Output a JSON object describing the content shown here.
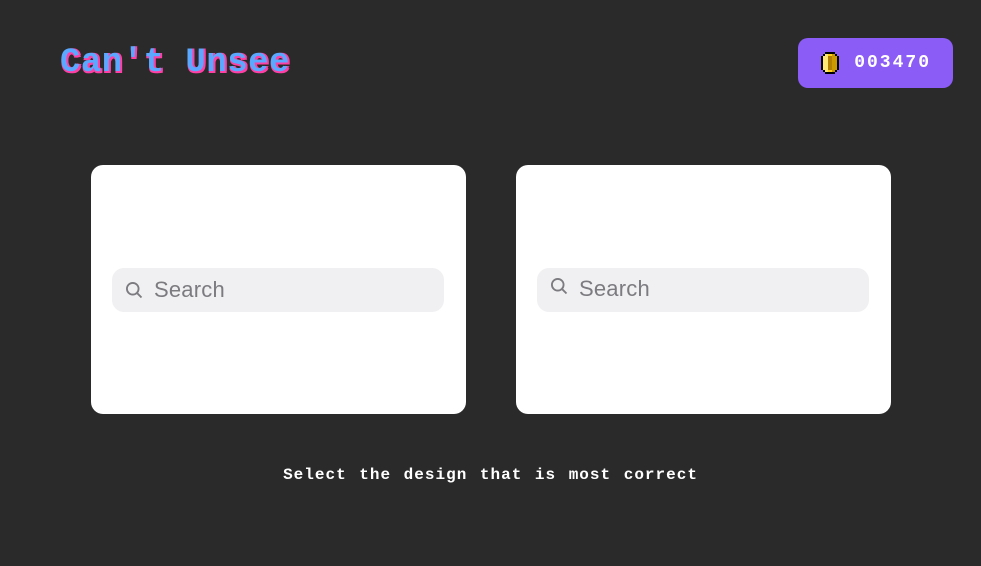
{
  "header": {
    "logo_text": "Can't Unsee",
    "score_label": "003470",
    "coin_icon": "coin-icon"
  },
  "cards": {
    "left": {
      "placeholder": "Search"
    },
    "right": {
      "placeholder": "Search"
    }
  },
  "instruction": "Select the design that is most correct",
  "colors": {
    "bg": "#2a2a2a",
    "accent": "#8c5cf6",
    "logo_cyan": "#5aa8ff",
    "logo_magenta": "#ff3fa4",
    "card_bg": "#ffffff",
    "search_bg": "#f0f0f2",
    "placeholder": "#7b7b80"
  }
}
